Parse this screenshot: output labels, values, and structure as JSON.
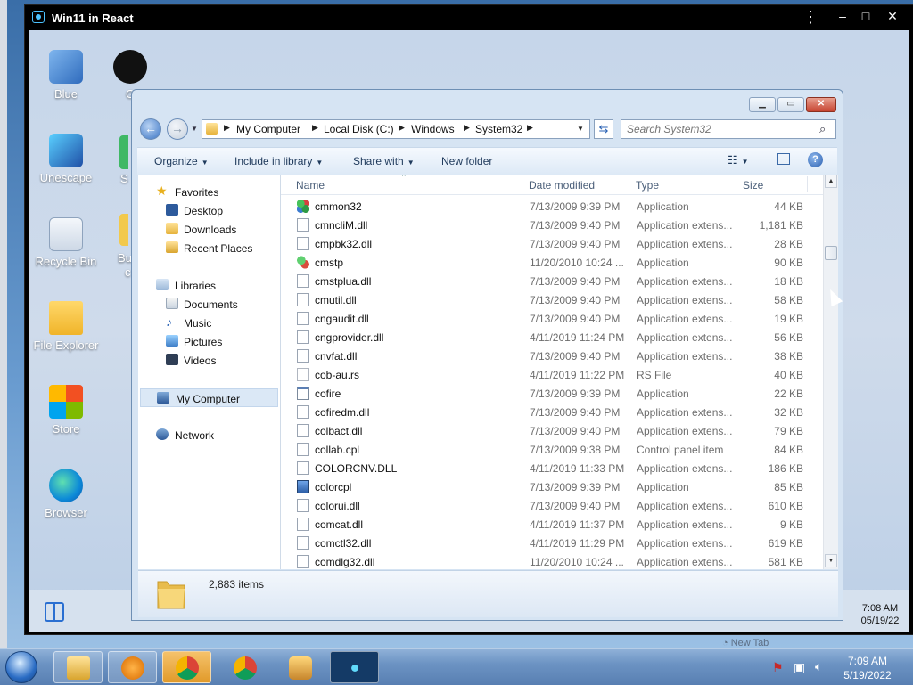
{
  "emulator": {
    "title": "Win11 in React"
  },
  "desktop": {
    "icons": [
      {
        "label": "Blue",
        "icon": "user-computer-icon"
      },
      {
        "label": "G",
        "icon": "github-icon"
      },
      {
        "label": "Unescape",
        "icon": "unescape-icon"
      },
      {
        "label": "Recycle Bin",
        "icon": "recycle-bin-icon"
      },
      {
        "label": "File Explorer",
        "icon": "folder-icon"
      },
      {
        "label": "Store",
        "icon": "store-icon"
      },
      {
        "label": "Browser",
        "icon": "edge-icon"
      }
    ],
    "partial_labels": [
      "S",
      "Bu",
      "c"
    ],
    "clock": {
      "time": "7:08 AM",
      "date": "05/19/22"
    }
  },
  "explorer": {
    "address": [
      "My Computer",
      "Local Disk (C:)",
      "Windows",
      "System32"
    ],
    "search_placeholder": "Search System32",
    "commands": {
      "organize": "Organize",
      "include": "Include in library",
      "share": "Share with",
      "newfolder": "New folder"
    },
    "nav": {
      "favorites": "Favorites",
      "desktop": "Desktop",
      "downloads": "Downloads",
      "recent": "Recent Places",
      "libraries": "Libraries",
      "documents": "Documents",
      "music": "Music",
      "pictures": "Pictures",
      "videos": "Videos",
      "mycomputer": "My Computer",
      "network": "Network"
    },
    "columns": {
      "name": "Name",
      "date": "Date modified",
      "type": "Type",
      "size": "Size"
    },
    "files": [
      {
        "name": "cmmon32",
        "date": "7/13/2009 9:39 PM",
        "type": "Application",
        "size": "44 KB",
        "icon": "cmmon-app-icon"
      },
      {
        "name": "cmncliM.dll",
        "date": "7/13/2009 9:40 PM",
        "type": "Application extens...",
        "size": "1,181 KB",
        "icon": "dll-file-icon"
      },
      {
        "name": "cmpbk32.dll",
        "date": "7/13/2009 9:40 PM",
        "type": "Application extens...",
        "size": "28 KB",
        "icon": "dll-file-icon"
      },
      {
        "name": "cmstp",
        "date": "11/20/2010 10:24 ...",
        "type": "Application",
        "size": "90 KB",
        "icon": "cmstp-app-icon"
      },
      {
        "name": "cmstplua.dll",
        "date": "7/13/2009 9:40 PM",
        "type": "Application extens...",
        "size": "18 KB",
        "icon": "dll-file-icon"
      },
      {
        "name": "cmutil.dll",
        "date": "7/13/2009 9:40 PM",
        "type": "Application extens...",
        "size": "58 KB",
        "icon": "dll-file-icon"
      },
      {
        "name": "cngaudit.dll",
        "date": "7/13/2009 9:40 PM",
        "type": "Application extens...",
        "size": "19 KB",
        "icon": "dll-file-icon"
      },
      {
        "name": "cngprovider.dll",
        "date": "4/11/2019 11:24 PM",
        "type": "Application extens...",
        "size": "56 KB",
        "icon": "dll-file-icon"
      },
      {
        "name": "cnvfat.dll",
        "date": "7/13/2009 9:40 PM",
        "type": "Application extens...",
        "size": "38 KB",
        "icon": "dll-file-icon"
      },
      {
        "name": "cob-au.rs",
        "date": "4/11/2019 11:22 PM",
        "type": "RS File",
        "size": "40 KB",
        "icon": "blank-file-icon"
      },
      {
        "name": "cofire",
        "date": "7/13/2009 9:39 PM",
        "type": "Application",
        "size": "22 KB",
        "icon": "app-window-icon"
      },
      {
        "name": "cofiredm.dll",
        "date": "7/13/2009 9:40 PM",
        "type": "Application extens...",
        "size": "32 KB",
        "icon": "dll-file-icon"
      },
      {
        "name": "colbact.dll",
        "date": "7/13/2009 9:40 PM",
        "type": "Application extens...",
        "size": "79 KB",
        "icon": "dll-file-icon"
      },
      {
        "name": "collab.cpl",
        "date": "7/13/2009 9:38 PM",
        "type": "Control panel item",
        "size": "84 KB",
        "icon": "dll-file-icon"
      },
      {
        "name": "COLORCNV.DLL",
        "date": "4/11/2019 11:33 PM",
        "type": "Application extens...",
        "size": "186 KB",
        "icon": "dll-file-icon"
      },
      {
        "name": "colorcpl",
        "date": "7/13/2009 9:39 PM",
        "type": "Application",
        "size": "85 KB",
        "icon": "monitor-app-icon"
      },
      {
        "name": "colorui.dll",
        "date": "7/13/2009 9:40 PM",
        "type": "Application extens...",
        "size": "610 KB",
        "icon": "dll-file-icon"
      },
      {
        "name": "comcat.dll",
        "date": "4/11/2019 11:37 PM",
        "type": "Application extens...",
        "size": "9 KB",
        "icon": "dll-file-icon"
      },
      {
        "name": "comctl32.dll",
        "date": "4/11/2019 11:29 PM",
        "type": "Application extens...",
        "size": "619 KB",
        "icon": "dll-file-icon"
      },
      {
        "name": "comdlg32.dll",
        "date": "11/20/2010 10:24 ...",
        "type": "Application extens...",
        "size": "581 KB",
        "icon": "dll-file-icon"
      }
    ],
    "status_count": "2,883 items"
  },
  "host": {
    "tooltip": "New Tab",
    "clock": {
      "time": "7:09 AM",
      "date": "5/19/2022"
    }
  }
}
